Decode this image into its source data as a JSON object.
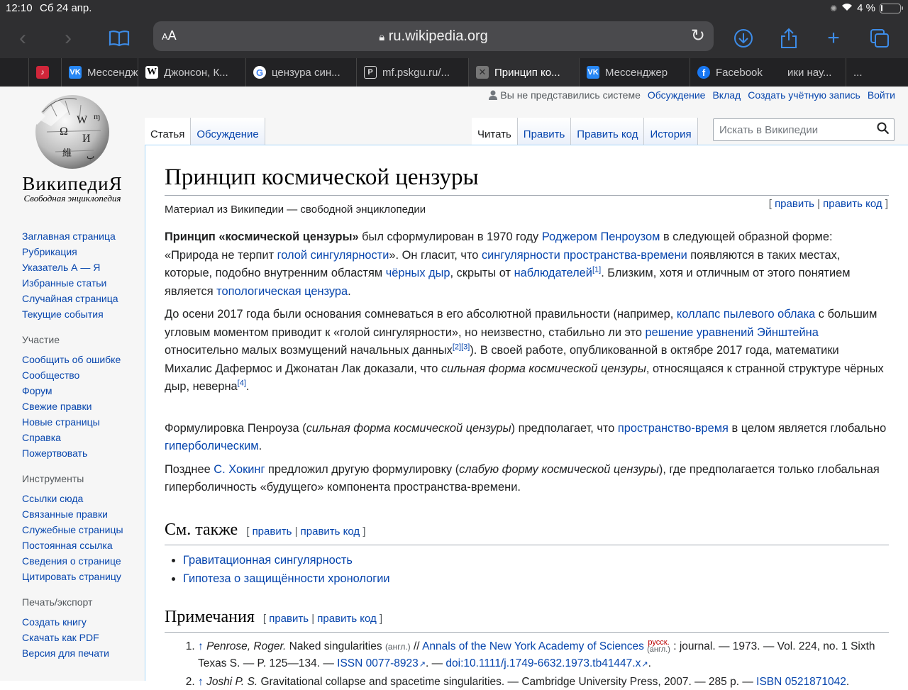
{
  "status_bar": {
    "time": "12:10",
    "date": "Сб 24 апр.",
    "battery": "4 %",
    "battery_level": 0.04
  },
  "toolbar": {
    "aa": "AA",
    "url": "ru.wikipedia.org"
  },
  "browser_tabs": [
    {
      "label": "",
      "icon": "music-icon",
      "color": "#d0263a"
    },
    {
      "label": "Мессендж",
      "icon": "vk-icon",
      "color": "#2787f5"
    },
    {
      "label": "Джонсон, К...",
      "icon": "wikipedia-icon",
      "color": "#ffffff"
    },
    {
      "label": "цензура син...",
      "icon": "google-icon",
      "color": "#ffffff"
    },
    {
      "label": "mf.pskgu.ru/...",
      "icon": "p-icon",
      "color": "#2f2f31"
    },
    {
      "label": "Принцип ко...",
      "icon": "close-icon",
      "color": "#888888",
      "active": true
    },
    {
      "label": "Мессенджер",
      "icon": "vk-icon",
      "color": "#2787f5"
    },
    {
      "label": "Facebook",
      "icon": "facebook-icon",
      "color": "#1877f2"
    },
    {
      "label": "ики нау...",
      "icon": "",
      "color": ""
    },
    {
      "label": "...",
      "icon": "",
      "color": ""
    }
  ],
  "logo": {
    "wordmark": "ВикипедиЯ",
    "tagline": "Свободная энциклопедия"
  },
  "personal": {
    "not_logged": "Вы не представились системе",
    "talk": "Обсуждение",
    "contrib": "Вклад",
    "create": "Создать учётную запись",
    "login": "Войти"
  },
  "sidebar": {
    "nav": [
      "Заглавная страница",
      "Рубрикация",
      "Указатель А — Я",
      "Избранные статьи",
      "Случайная страница",
      "Текущие события"
    ],
    "participation_title": "Участие",
    "participation": [
      "Сообщить об ошибке",
      "Сообщество",
      "Форум",
      "Свежие правки",
      "Новые страницы",
      "Справка",
      "Пожертвовать"
    ],
    "tools_title": "Инструменты",
    "tools": [
      "Ссылки сюда",
      "Связанные правки",
      "Служебные страницы",
      "Постоянная ссылка",
      "Сведения о странице",
      "Цитировать страницу"
    ],
    "print_title": "Печать/экспорт",
    "print": [
      "Создать книгу",
      "Скачать как PDF",
      "Версия для печати"
    ]
  },
  "page_tabs": {
    "article": "Статья",
    "talk": "Обсуждение",
    "read": "Читать",
    "edit": "Править",
    "edit_source": "Править код",
    "history": "История"
  },
  "search": {
    "placeholder": "Искать в Википедии"
  },
  "article": {
    "title": "Принцип космической цензуры",
    "subtitle": "Материал из Википедии — свободной энциклопедии",
    "edit": "править",
    "edit_source": "править код",
    "p1": {
      "b": "Принцип «космической цензуры»",
      "t1": " был сформулирован в 1970 году ",
      "l1": "Роджером Пенроузом",
      "t2": " в следующей образной форме: «Природа не терпит ",
      "l2": "голой сингулярности",
      "t3": "». Он гласит, что ",
      "l3": "сингулярности пространства-времени",
      "t4": " появляются в таких местах, которые, подобно внутренним областям ",
      "l4": "чёрных дыр",
      "t5": ", скрыты от ",
      "l5": "наблюдателей",
      "s1": "[1]",
      "t6": ". Близким, хотя и отличным от этого понятием является ",
      "l6": "топологическая цензура",
      "t7": "."
    },
    "p2": {
      "t1": "До осени 2017 года были основания сомневаться в его абсолютной правильности (например, ",
      "l1": "коллапс пылевого облака",
      "t2": " с большим угловым моментом приводит к «голой сингулярности», но неизвестно, стабильно ли это ",
      "l2": "решение уравнений Эйнштейна",
      "t3": " относительно малых возмущений начальных данных",
      "s1": "[2]",
      "s2": "[3]",
      "t4": "). В своей работе, опубликованной в октябре 2017 года, математики Михалис Дафермос и Джонатан Лак доказали, что ",
      "i1": "сильная форма космической цензуры",
      "t5": ", относящаяся к странной структуре чёрных дыр, неверна",
      "s3": "[4]",
      "t6": "."
    },
    "p3": {
      "t1": "Формулировка Пенроуза (",
      "i1": "сильная форма космической цензуры",
      "t2": ") предполагает, что ",
      "l1": "пространство-время",
      "t3": " в целом является глобально ",
      "l2": "гиперболическим",
      "t4": "."
    },
    "p4": {
      "t1": "Позднее ",
      "l1": "С. Хокинг",
      "t2": " предложил другую формулировку (",
      "i1": "слабую форму космической цензуры",
      "t3": "), где предполагается только глобальная гиперболичность «будущего» компонента пространства-времени."
    },
    "see_also_title": "См. также",
    "see_also": [
      "Гравитационная сингулярность",
      "Гипотеза о защищённости хронологии"
    ],
    "notes_title": "Примечания",
    "ref1": {
      "arrow": "↑",
      "author": "Penrose, Roger.",
      "t1": " Naked singularities ",
      "lang": "(англ.)",
      "t2": " // ",
      "journal": "Annals of the New York Academy of Sciences",
      "rus": "русск.",
      "lang2": "(англ.)",
      "t3": " : journal. — 1973. — Vol. 224, no. 1 Sixth Texas S. — P. 125—134. — ",
      "issn_label": "ISSN",
      "issn": "0077-8923",
      "t4": ". — ",
      "doi_label": "doi",
      "doi": ":10.1111/j.1749-6632.1973.tb41447.x",
      "t5": "."
    },
    "ref2": {
      "arrow": "↑",
      "author": "Joshi P. S.",
      "t1": " Gravitational collapse and spacetime singularities. — Cambridge University Press, 2007. — 285 p. — ",
      "isbn_label": "ISBN",
      "isbn": "0521871042",
      "t2": "."
    }
  }
}
